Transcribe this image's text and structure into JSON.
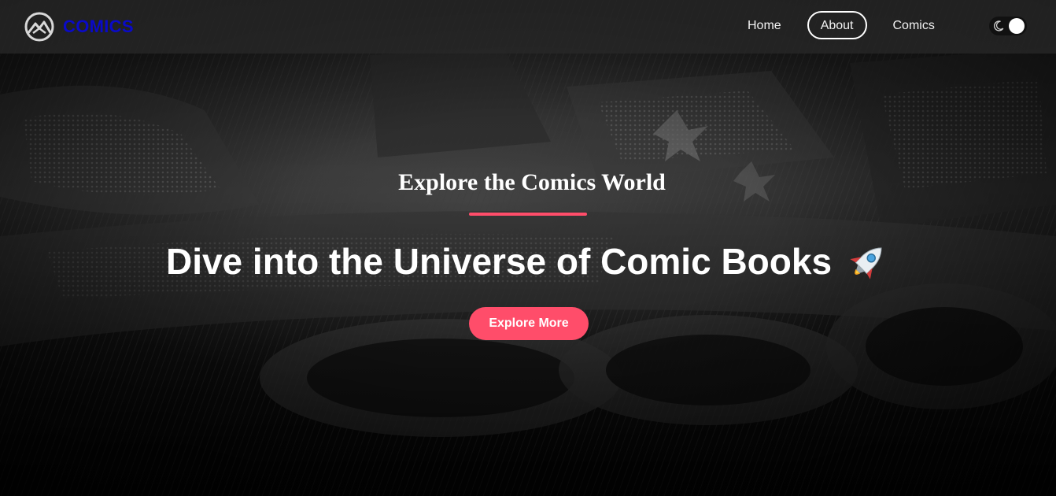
{
  "navbar": {
    "brand_name": "COMICS",
    "links": [
      {
        "label": "Home",
        "active": false
      },
      {
        "label": "About",
        "active": true
      },
      {
        "label": "Comics",
        "active": false
      }
    ],
    "theme_toggle": {
      "icon": "moon-icon",
      "state": "dark"
    }
  },
  "hero": {
    "subtitle": "Explore the Comics World",
    "title": "Dive into the Universe of Comic Books",
    "title_icon": "rocket-icon",
    "cta_label": "Explore More"
  },
  "colors": {
    "accent": "#ff4d6a",
    "brand_text": "#0a0ac8",
    "navbar_bg": "#282828"
  }
}
